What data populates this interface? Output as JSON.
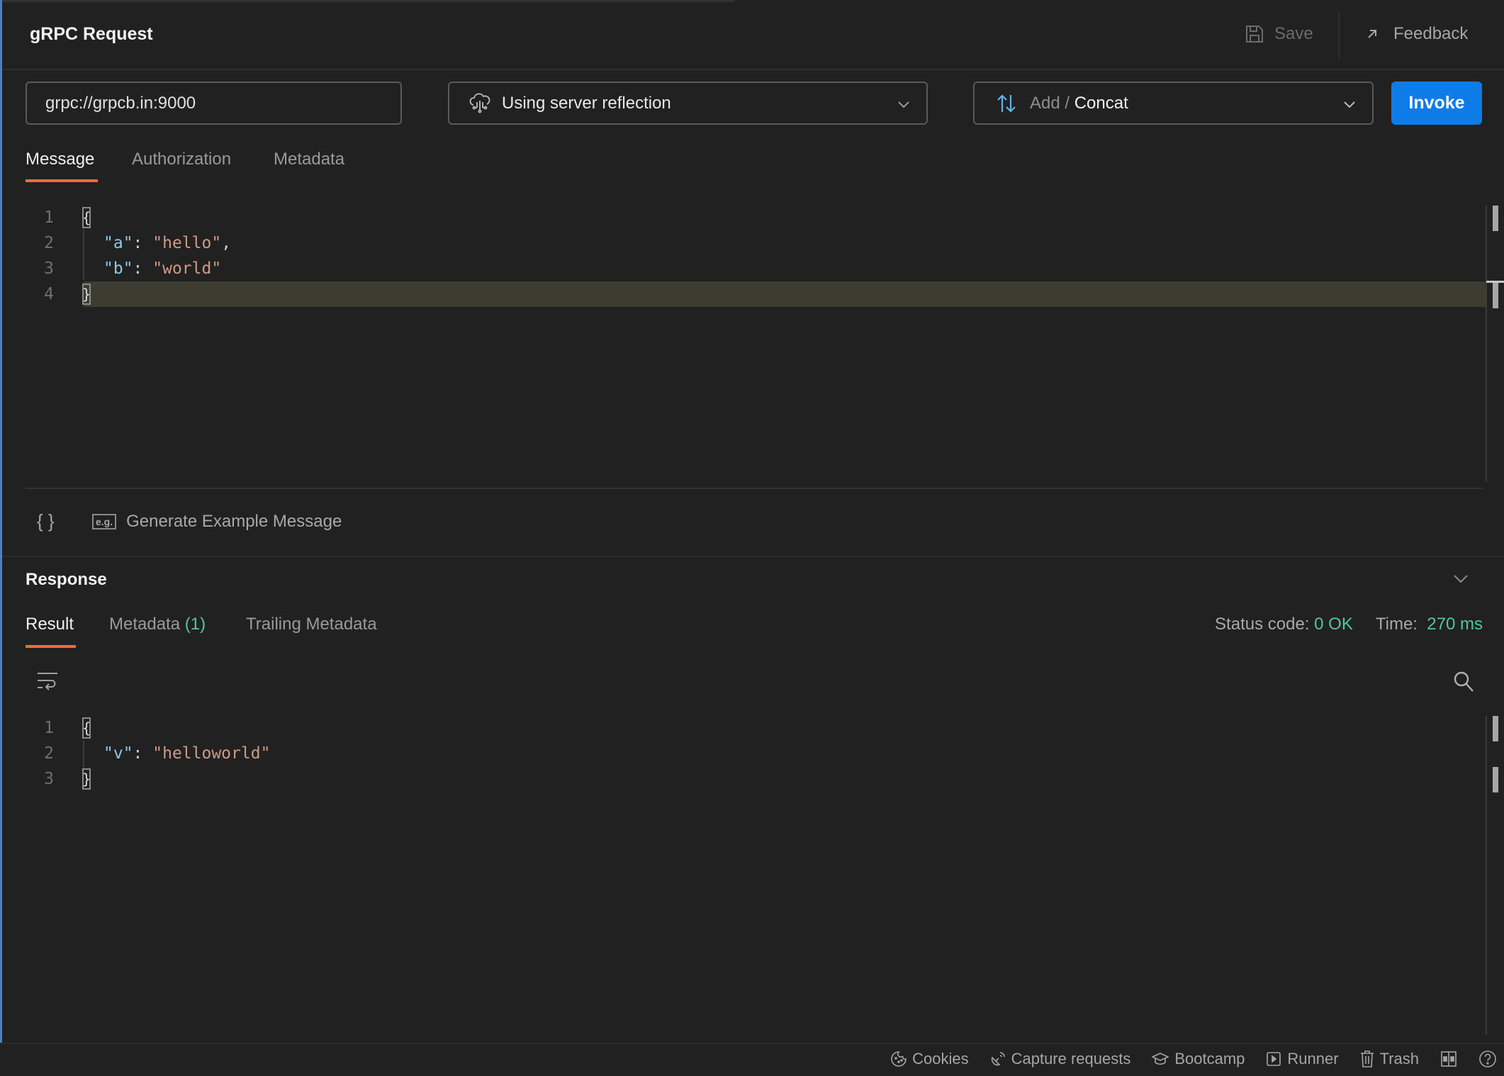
{
  "header": {
    "title": "gRPC Request",
    "save_label": "Save",
    "feedback_label": "Feedback"
  },
  "request": {
    "url": "grpc://grpcb.in:9000",
    "reflection_label": "Using server reflection",
    "method_service": "Add",
    "method_separator": " / ",
    "method_name": "Concat",
    "invoke_label": "Invoke"
  },
  "request_tabs": [
    {
      "label": "Message",
      "active": true
    },
    {
      "label": "Authorization",
      "active": false
    },
    {
      "label": "Metadata",
      "active": false
    }
  ],
  "message_editor": {
    "line_numbers": [
      "1",
      "2",
      "3",
      "4"
    ],
    "lines": [
      {
        "key": "\"a\"",
        "value": "\"hello\"",
        "trail": ","
      },
      {
        "key": "\"b\"",
        "value": "\"world\"",
        "trail": ""
      }
    ],
    "open": "{",
    "close": "}"
  },
  "editor_toolbar": {
    "beautify_icon_text": "{ }",
    "eg_badge": "e.g.",
    "generate_label": "Generate Example Message"
  },
  "response": {
    "title": "Response",
    "tabs": [
      {
        "label": "Result",
        "active": true
      },
      {
        "label": "Metadata",
        "count": "(1)",
        "active": false
      },
      {
        "label": "Trailing Metadata",
        "active": false
      }
    ],
    "status_label": "Status code:",
    "status_value": "0 OK",
    "time_label": "Time:",
    "time_value": "270 ms",
    "line_numbers": [
      "1",
      "2",
      "3"
    ],
    "lines": [
      {
        "key": "\"v\"",
        "value": "\"helloworld\""
      }
    ],
    "open": "{",
    "close": "}"
  },
  "footer": {
    "items": [
      {
        "label": "Cookies",
        "icon": "cookie-icon"
      },
      {
        "label": "Capture requests",
        "icon": "satellite-icon"
      },
      {
        "label": "Bootcamp",
        "icon": "graduation-cap-icon"
      },
      {
        "label": "Runner",
        "icon": "play-box-icon"
      },
      {
        "label": "Trash",
        "icon": "trash-icon"
      }
    ]
  },
  "colors": {
    "accent_tab": "#f26b3a",
    "invoke": "#0d7be8",
    "success": "#4fc79a"
  }
}
